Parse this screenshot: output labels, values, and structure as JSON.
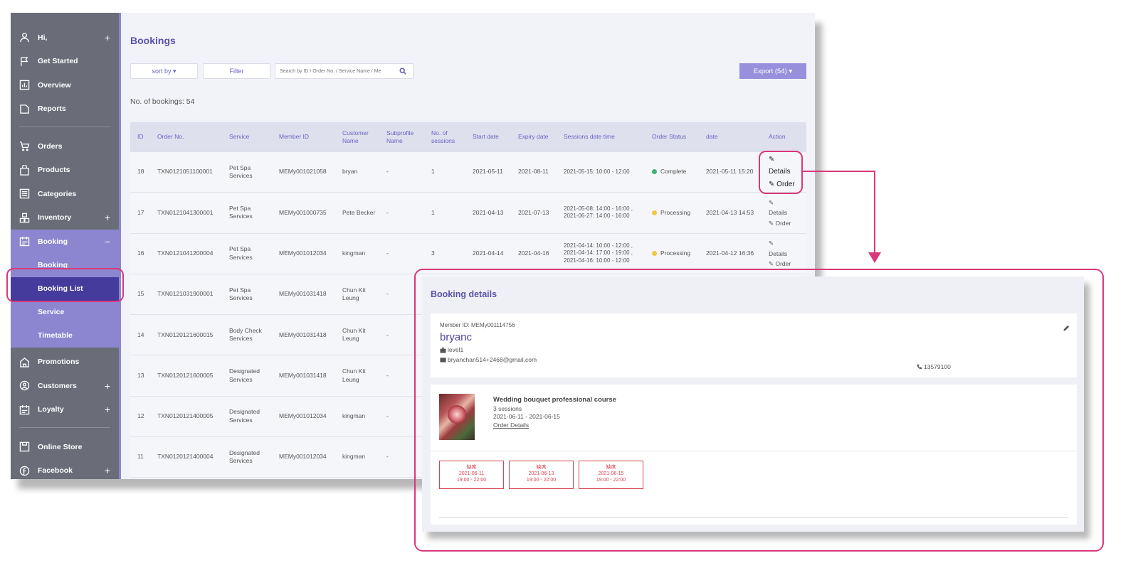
{
  "sidebar": {
    "greeting": "Hi,",
    "items_top": [
      {
        "label": "Get Started",
        "icon": "flag-icon"
      },
      {
        "label": "Overview",
        "icon": "chart-icon"
      },
      {
        "label": "Reports",
        "icon": "folder-icon"
      }
    ],
    "items_mid": [
      {
        "label": "Orders",
        "icon": "cart-icon"
      },
      {
        "label": "Products",
        "icon": "bag-icon"
      },
      {
        "label": "Categories",
        "icon": "list-icon"
      },
      {
        "label": "Inventory",
        "icon": "boxes-icon"
      }
    ],
    "booking": {
      "label": "Booking",
      "collapse": "−"
    },
    "booking_sub": [
      "Booking",
      "Booking List",
      "Service",
      "Timetable"
    ],
    "items_low": [
      {
        "label": "Promotions",
        "icon": "home-icon"
      },
      {
        "label": "Customers",
        "icon": "user-circle-icon"
      },
      {
        "label": "Loyalty",
        "icon": "calendar-icon"
      }
    ],
    "items_bottom": [
      {
        "label": "Online Store",
        "icon": "store-icon"
      },
      {
        "label": "Facebook",
        "icon": "facebook-icon"
      }
    ],
    "plus": "+"
  },
  "page": {
    "title": "Bookings",
    "sort_label": "sort by ▾",
    "filter_label": "Filter",
    "search_placeholder": "Search by ID / Order No. / Service Name / Me",
    "export_label": "Export (54) ▾",
    "count_label": "No. of bookings: 54"
  },
  "table": {
    "headers": [
      "ID",
      "Order No.",
      "Service",
      "Member ID",
      "Customer Name",
      "Subprofile Name",
      "No. of sessions",
      "Start date",
      "Expiry date",
      "Sessions date time",
      "Order Status",
      "date",
      "Action"
    ],
    "rows": [
      {
        "id": "18",
        "order": "TXN0121051100001",
        "service": "Pet Spa Services",
        "member": "MEMy001021058",
        "customer": "bryan",
        "sub": "-",
        "sessions": "1",
        "start": "2021-05-11",
        "expiry": "2021-08-11",
        "times": "2021-05-15: 10:00 - 12:00",
        "status": "Complete",
        "status_color": "#3cb371",
        "date": "2021-05-11 15:20"
      },
      {
        "id": "17",
        "order": "TXN0121041300001",
        "service": "Pet Spa Services",
        "member": "MEMy001000735",
        "customer": "Pete Becker",
        "sub": "-",
        "sessions": "1",
        "start": "2021-04-13",
        "expiry": "2021-07-13",
        "times": "2021-05-08: 14:00 - 16:00 , 2021-06-27: 14:00 - 16:00",
        "status": "Processing",
        "status_color": "#f3c544",
        "date": "2021-04-13 14:53"
      },
      {
        "id": "16",
        "order": "TXN0121041200004",
        "service": "Pet Spa Services",
        "member": "MEMy001012034",
        "customer": "kingman",
        "sub": "-",
        "sessions": "3",
        "start": "2021-04-14",
        "expiry": "2021-04-16",
        "times": "2021-04-14: 10:00 - 12:00 , 2021-04-14: 17:00 - 19:00 , 2021-04-16: 10:00 - 12:00",
        "status": "Processing",
        "status_color": "#f3c544",
        "date": "2021-04-12 16:36"
      },
      {
        "id": "15",
        "order": "TXN0121031900001",
        "service": "Pet Spa Services",
        "member": "MEMy001031418",
        "customer": "Chun Kit Leung",
        "sub": "-"
      },
      {
        "id": "14",
        "order": "TXN0120121600015",
        "service": "Body Check Services",
        "member": "MEMy001031418",
        "customer": "Chun Kit Leung",
        "sub": "-"
      },
      {
        "id": "13",
        "order": "TXN0120121600005",
        "service": "Designated Services",
        "member": "MEMy001031418",
        "customer": "Chun Kit Leung",
        "sub": "-"
      },
      {
        "id": "12",
        "order": "TXN0120121400005",
        "service": "Designated Services",
        "member": "MEMy001012034",
        "customer": "kingman",
        "sub": "-"
      },
      {
        "id": "11",
        "order": "TXN0120121400004",
        "service": "Designated Services",
        "member": "MEMy001012034",
        "customer": "kingman",
        "sub": "-"
      }
    ],
    "action_details": "Details",
    "action_order": "Order"
  },
  "details": {
    "title": "Booking details",
    "member_id_label": "Member ID: MEMy001114756",
    "name": "bryanc",
    "level": "level1",
    "email": "bryanchan514+2468@gmail.com",
    "phone": "13579100",
    "course_title": "Wedding bouquet professional course",
    "course_sessions": "3 sessions",
    "course_range": "2021-06-11 - 2021-06-15",
    "order_details_link": "Order Details",
    "sessions": [
      {
        "status": "缺席",
        "date": "2021-06-11",
        "time": "19:00 - 22:00"
      },
      {
        "status": "缺席",
        "date": "2021-06-13",
        "time": "19:00 - 22:00"
      },
      {
        "status": "缺席",
        "date": "2021-06-15",
        "time": "19:00 - 22:00"
      }
    ]
  },
  "colors": {
    "accent": "#5a53ad",
    "highlight": "#d9387a",
    "sidebar": "#6a6d78",
    "active": "#443b9c"
  }
}
